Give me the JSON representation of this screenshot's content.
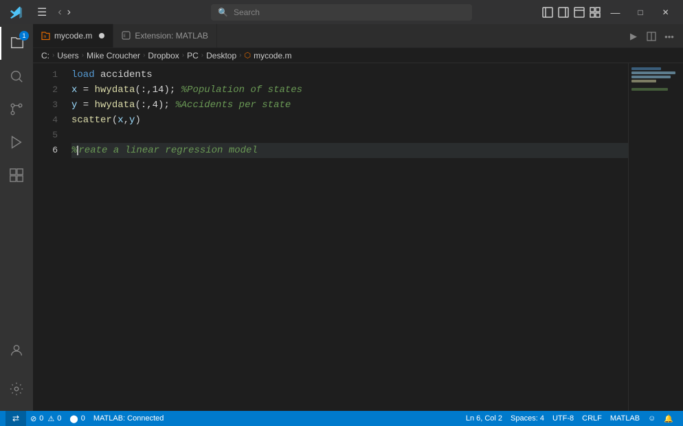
{
  "titlebar": {
    "search_placeholder": "Search",
    "nav_back_label": "◀",
    "nav_forward_label": "▶",
    "layout_btn1": "⬜",
    "layout_btn2": "⬜",
    "layout_btn3": "⬜",
    "layout_btn4": "⊞",
    "win_min": "—",
    "win_max": "□",
    "win_close": "✕"
  },
  "activity_bar": {
    "explorer_label": "Explorer",
    "search_label": "Search",
    "source_control_label": "Source Control",
    "run_label": "Run and Debug",
    "extensions_label": "Extensions",
    "accounts_label": "Accounts",
    "settings_label": "Settings",
    "badge_count": "1"
  },
  "tabs": [
    {
      "id": "mycode",
      "label": "mycode.m",
      "active": true,
      "modified": true,
      "icon": "matlab"
    },
    {
      "id": "extension-matlab",
      "label": "Extension: MATLAB",
      "active": false,
      "modified": false,
      "icon": "ext"
    }
  ],
  "breadcrumb": {
    "items": [
      "C:",
      "Users",
      "Mike Croucher",
      "Dropbox",
      "PC",
      "Desktop",
      "mycode.m"
    ]
  },
  "code": {
    "lines": [
      {
        "num": 1,
        "tokens": [
          {
            "t": "kw",
            "v": "load"
          },
          {
            "t": "plain",
            "v": " accidents"
          }
        ]
      },
      {
        "num": 2,
        "tokens": [
          {
            "t": "var",
            "v": "x"
          },
          {
            "t": "plain",
            "v": " = "
          },
          {
            "t": "fn",
            "v": "hwydata"
          },
          {
            "t": "punc",
            "v": "(:,14); "
          },
          {
            "t": "cmt",
            "v": "%Population of states"
          }
        ]
      },
      {
        "num": 3,
        "tokens": [
          {
            "t": "var",
            "v": "y"
          },
          {
            "t": "plain",
            "v": " = "
          },
          {
            "t": "fn",
            "v": "hwydata"
          },
          {
            "t": "punc",
            "v": "(:,4); "
          },
          {
            "t": "cmt",
            "v": "%Accidents per state"
          }
        ]
      },
      {
        "num": 4,
        "tokens": [
          {
            "t": "fn",
            "v": "scatter"
          },
          {
            "t": "punc",
            "v": "("
          },
          {
            "t": "var",
            "v": "x"
          },
          {
            "t": "punc",
            "v": ","
          },
          {
            "t": "var",
            "v": "y"
          },
          {
            "t": "punc",
            "v": ")"
          }
        ]
      },
      {
        "num": 5,
        "tokens": []
      },
      {
        "num": 6,
        "tokens": [
          {
            "t": "cmt",
            "v": "%"
          },
          {
            "t": "cursor",
            "v": ""
          },
          {
            "t": "cmt",
            "v": "reate a linear regression model"
          }
        ]
      }
    ],
    "active_line": 6
  },
  "status": {
    "error_count": "0",
    "warning_count": "0",
    "info_count": "0",
    "no_problems_icon": "⊘",
    "mic_icon": "🎤",
    "mic_count": "0",
    "matlab_status": "MATLAB: Connected",
    "cursor_pos": "Ln 6, Col 2",
    "spaces": "Spaces: 4",
    "encoding": "UTF-8",
    "line_ending": "CRLF",
    "language": "MATLAB",
    "feedback_icon": "☺",
    "bell_icon": "🔔"
  }
}
